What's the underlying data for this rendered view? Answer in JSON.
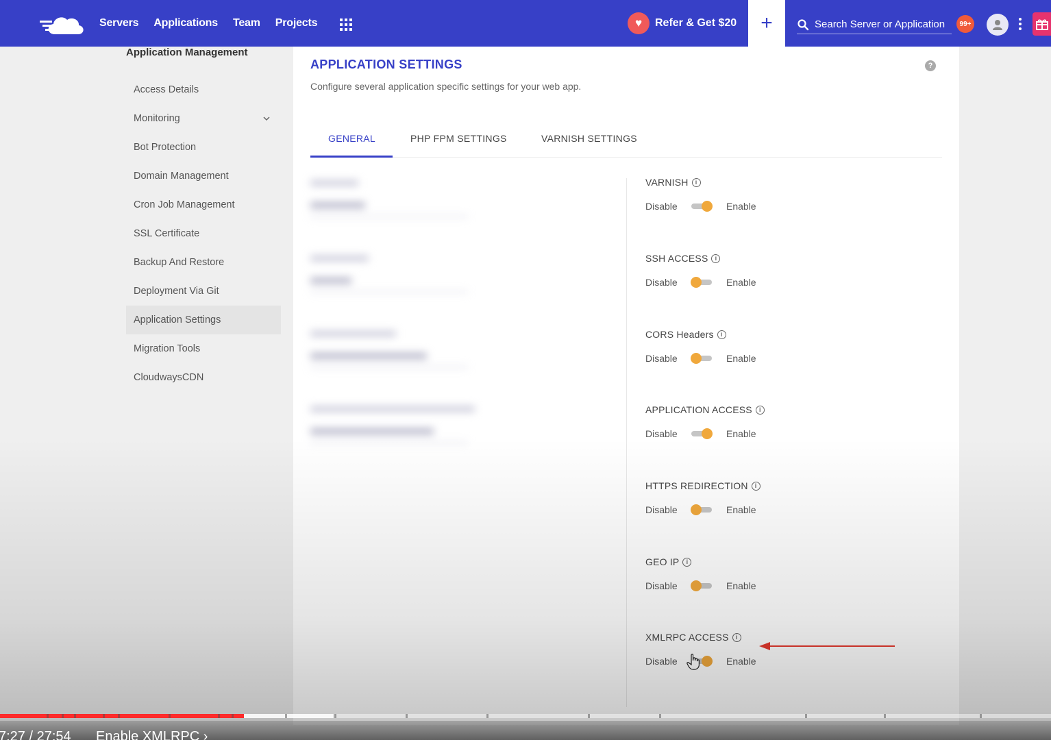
{
  "topbar": {
    "nav": [
      "Servers",
      "Applications",
      "Team",
      "Projects"
    ],
    "refer_label": "Refer & Get $20",
    "add_label": "+",
    "search_placeholder": "Search Server or Application",
    "notif_count": "99+",
    "accent_color": "#3740c7"
  },
  "sidebar": {
    "header": "Application Management",
    "items": [
      {
        "label": "Access Details"
      },
      {
        "label": "Monitoring"
      },
      {
        "label": "Bot Protection"
      },
      {
        "label": "Domain Management"
      },
      {
        "label": "Cron Job Management"
      },
      {
        "label": "SSL Certificate"
      },
      {
        "label": "Backup And Restore"
      },
      {
        "label": "Deployment Via Git"
      },
      {
        "label": "Application Settings"
      },
      {
        "label": "Migration Tools"
      },
      {
        "label": "CloudwaysCDN"
      }
    ],
    "active": "Application Settings"
  },
  "panel": {
    "title": "APPLICATION SETTINGS",
    "subtitle": "Configure several application specific settings for your web app.",
    "help": "?",
    "tabs": [
      "GENERAL",
      "PHP FPM SETTINGS",
      "VARNISH SETTINGS"
    ],
    "active_tab": "GENERAL"
  },
  "settings": {
    "disable_label": "Disable",
    "enable_label": "Enable",
    "items": [
      {
        "label": "VARNISH",
        "state": "on"
      },
      {
        "label": "SSH ACCESS",
        "state": "off"
      },
      {
        "label": "CORS Headers",
        "state": "off"
      },
      {
        "label": "APPLICATION ACCESS",
        "state": "on"
      },
      {
        "label": "HTTPS REDIRECTION",
        "state": "off"
      },
      {
        "label": "GEO IP",
        "state": "off"
      },
      {
        "label": "XMLRPC ACCESS",
        "state": "on"
      }
    ]
  },
  "player": {
    "time": "7:27 / 27:54",
    "chapter": "Enable XMLRPC",
    "chapter_chevron": "›",
    "played_fraction": 0.232,
    "buffered_fraction": 0.317
  }
}
